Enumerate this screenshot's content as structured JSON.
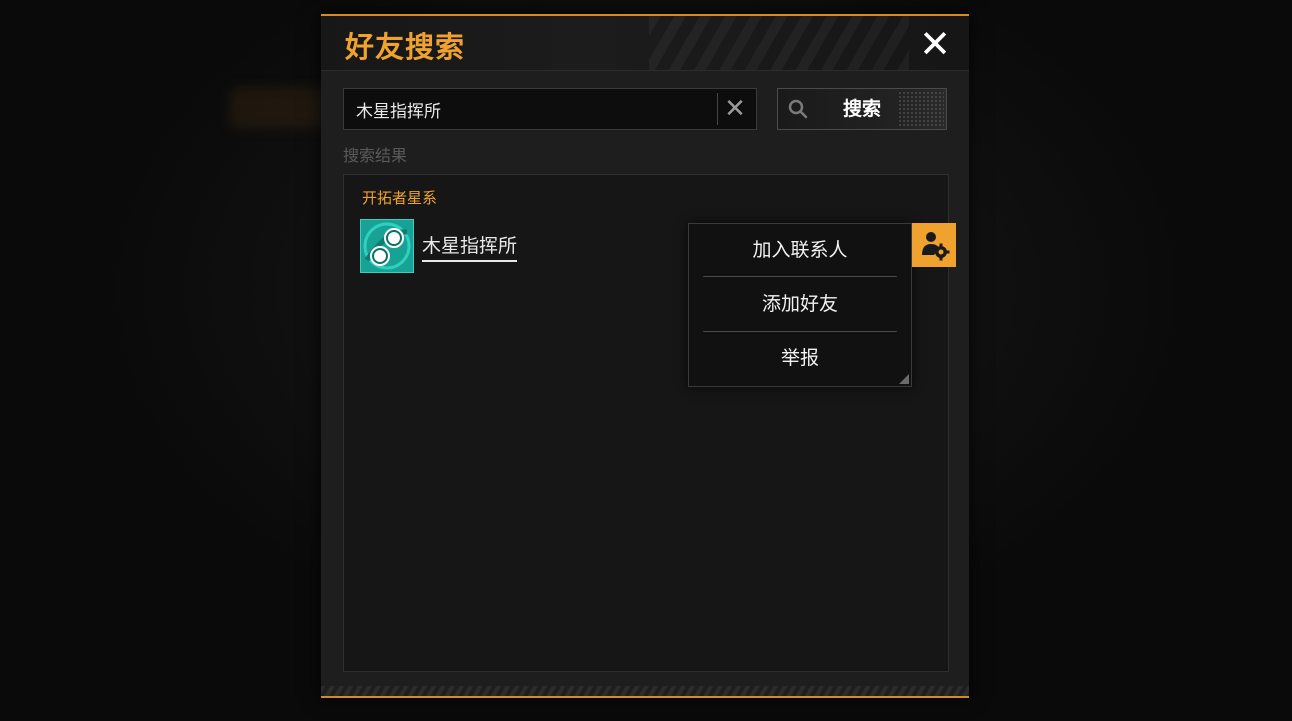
{
  "dialog": {
    "title": "好友搜索",
    "close_icon": "close-icon"
  },
  "search": {
    "value": "木星指挥所",
    "clear_icon": "clear-icon",
    "button_label": "搜索",
    "button_icon": "search-icon"
  },
  "results": {
    "label": "搜索结果",
    "group_name": "开拓者星系",
    "items": [
      {
        "name": "木星指挥所",
        "avatar_icon": "planet-avatar-icon"
      }
    ]
  },
  "context_menu": {
    "items": [
      {
        "label": "加入联系人"
      },
      {
        "label": "添加好友"
      },
      {
        "label": "举报"
      }
    ]
  },
  "action_button": {
    "icon": "user-gear-icon"
  },
  "colors": {
    "accent": "#f0a22e",
    "panel": "#1e1e1e",
    "text": "#e8e8e8",
    "muted": "#5a5a5a",
    "avatar": "#1aa79a"
  }
}
